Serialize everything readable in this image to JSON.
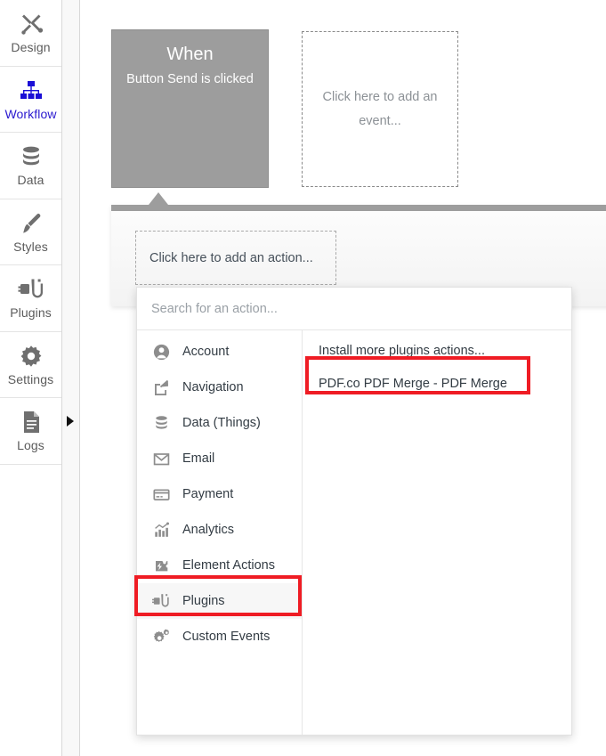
{
  "sidebar": {
    "items": [
      {
        "label": "Design",
        "icon": "design-tools-icon",
        "active": false
      },
      {
        "label": "Workflow",
        "icon": "workflow-tree-icon",
        "active": true
      },
      {
        "label": "Data",
        "icon": "database-icon",
        "active": false
      },
      {
        "label": "Styles",
        "icon": "paintbrush-icon",
        "active": false
      },
      {
        "label": "Plugins",
        "icon": "plug-icon",
        "active": false
      },
      {
        "label": "Settings",
        "icon": "gear-icon",
        "active": false
      },
      {
        "label": "Logs",
        "icon": "document-lines-icon",
        "active": false
      }
    ],
    "expander_icon": "right-triangle-icon"
  },
  "canvas": {
    "when_block": {
      "title": "When",
      "subtitle": "Button Send is clicked"
    },
    "add_event_placeholder": "Click here to add an event...",
    "add_action_placeholder": "Click here to add an action..."
  },
  "dropdown": {
    "search": {
      "placeholder": "Search for an action...",
      "value": ""
    },
    "categories": [
      {
        "label": "Account",
        "icon": "user-circle-icon",
        "selected": false
      },
      {
        "label": "Navigation",
        "icon": "share-arrow-icon",
        "selected": false
      },
      {
        "label": "Data (Things)",
        "icon": "database-icon",
        "selected": false
      },
      {
        "label": "Email",
        "icon": "envelope-icon",
        "selected": false
      },
      {
        "label": "Payment",
        "icon": "credit-card-icon",
        "selected": false
      },
      {
        "label": "Analytics",
        "icon": "bar-chart-icon",
        "selected": false
      },
      {
        "label": "Element Actions",
        "icon": "puzzle-bolt-icon",
        "selected": false
      },
      {
        "label": "Plugins",
        "icon": "plug-icon",
        "selected": true
      },
      {
        "label": "Custom Events",
        "icon": "gears-icon",
        "selected": false
      }
    ],
    "right_items": [
      {
        "label": "Install more plugins actions...",
        "highlighted": false
      },
      {
        "label": "PDF.co PDF Merge - PDF Merge",
        "highlighted": true
      }
    ]
  },
  "annotations": {
    "highlight_color": "#ef1c24",
    "boxes": [
      {
        "name": "plugins-category-highlight",
        "target": "Plugins"
      },
      {
        "name": "pdfco-action-highlight",
        "target": "PDF.co PDF Merge - PDF Merge"
      }
    ]
  },
  "colors": {
    "when_block_bg": "#9d9d9d",
    "active_nav": "#2a19cf",
    "nav_text": "#5b5b5b",
    "placeholder_text": "#8c9196",
    "highlight": "#ef1c24"
  }
}
